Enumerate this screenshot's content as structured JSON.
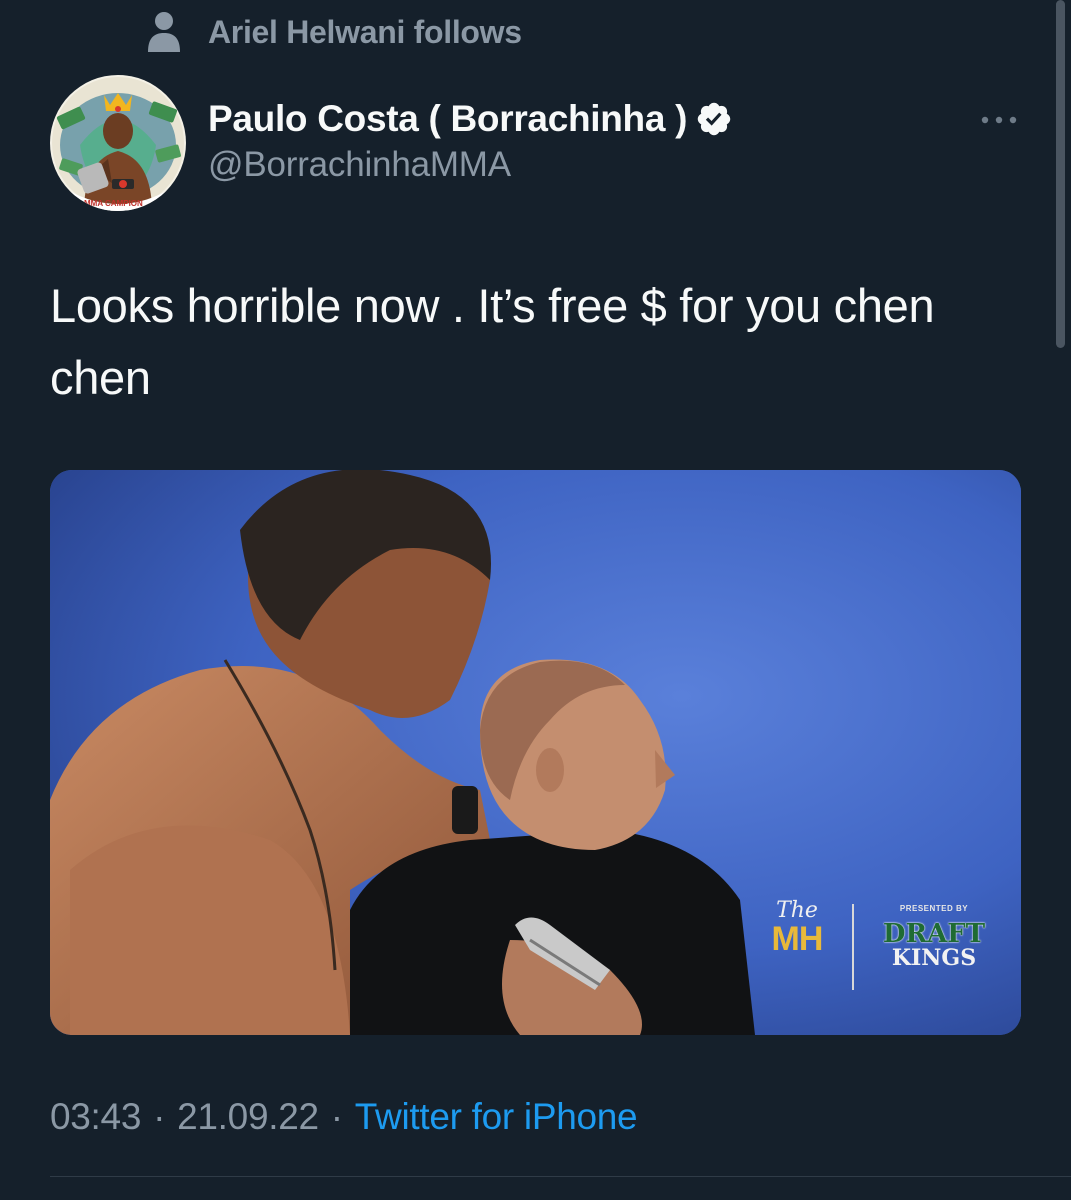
{
  "social_context": {
    "icon": "person-icon",
    "text": "Ariel Helwani follows"
  },
  "author": {
    "avatar_icon": "profile-avatar",
    "avatar_caption": "MMA CAMPION",
    "display_name": "Paulo Costa ( Borrachinha )",
    "verified_icon": "verified-badge-icon",
    "handle": "@BorrachinhaMMA"
  },
  "more_button": {
    "icon": "more-dots-icon"
  },
  "tweet": {
    "text": "Looks horrible now . It’s free $ for you chen chen"
  },
  "media": {
    "watermark": {
      "show_the": "The",
      "show_mh": "MH",
      "presented_by": "PRESENTED BY",
      "sponsor_line1": "DRAFT",
      "sponsor_line2": "KINGS"
    }
  },
  "meta": {
    "time": "03:43",
    "separator": "·",
    "date": "21.09.22",
    "source": "Twitter for iPhone"
  },
  "colors": {
    "background": "#15202b",
    "primary_text": "#f7f9f9",
    "secondary_text": "#8b98a5",
    "link": "#1d9bf0",
    "media_background": "#3f64c4"
  }
}
